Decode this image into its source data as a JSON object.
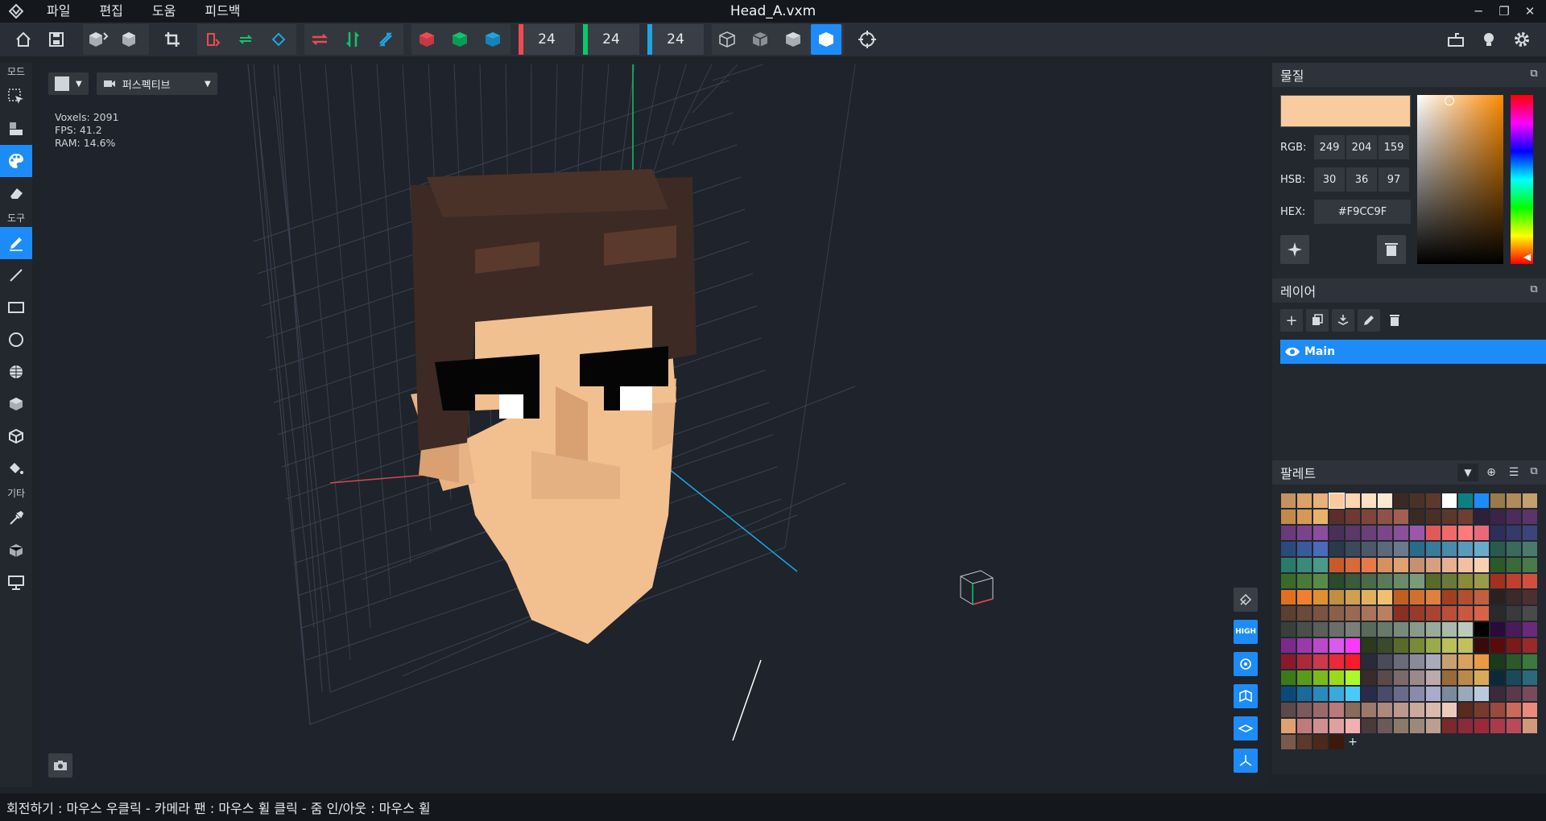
{
  "app": {
    "title": "Head_A.vxm"
  },
  "menu": [
    "파일",
    "편집",
    "도움",
    "피드백"
  ],
  "toolbar": {
    "size_x": "24",
    "size_y": "24",
    "size_z": "24"
  },
  "left_tools": {
    "mode_label": "모드",
    "tools_label": "도구",
    "other_label": "기타"
  },
  "viewport": {
    "view_mode": "퍼스펙티브",
    "stats": {
      "voxels": "Voxels: 2091",
      "fps": "FPS: 41.2",
      "ram": "RAM: 14.6%"
    },
    "quality": "HIGH"
  },
  "material": {
    "title": "물질",
    "color": "#F9CC9F",
    "rgb_label": "RGB:",
    "rgb": [
      "249",
      "204",
      "159"
    ],
    "hsb_label": "HSB:",
    "hsb": [
      "30",
      "36",
      "97"
    ],
    "hex_label": "HEX:",
    "hex": "#F9CC9F"
  },
  "layers": {
    "title": "레이어",
    "items": [
      {
        "name": "Main",
        "visible": true,
        "selected": true
      }
    ]
  },
  "palette": {
    "title": "팔레트",
    "colors": [
      "#c4915f",
      "#d9a26b",
      "#e8b07a",
      "#f9cc9f",
      "#fbd6b0",
      "#fce0c3",
      "#fde9d3",
      "#3a2a24",
      "#4a3128",
      "#5b3a2e",
      "#ffffff",
      "#0d7f82",
      "#1d8cf8",
      "#9a7a4a",
      "#b08c5a",
      "#c4a06c",
      "#c08a4a",
      "#d49a55",
      "#e6b36a",
      "#5a2f2a",
      "#6b3a33",
      "#7d463d",
      "#8f5248",
      "#a15f52",
      "#3a2a24",
      "#4a2f26",
      "#5b372c",
      "#6d3f31",
      "#2e1f3a",
      "#3a2448",
      "#4a2d5a",
      "#5a356a",
      "#6a3a7a",
      "#7a448a",
      "#8a4e9a",
      "#4a3058",
      "#5a3868",
      "#6a4078",
      "#7a4888",
      "#8a5098",
      "#9a58a8",
      "#e05a5a",
      "#f06a6a",
      "#ff7a7a",
      "#e86a7a",
      "#2c2f5a",
      "#343a6a",
      "#3c457a",
      "#2a4a7a",
      "#3a5a9a",
      "#4a6aba",
      "#2a3a4a",
      "#3a4a5a",
      "#4a5a6a",
      "#5a6a7a",
      "#6a7a8a",
      "#2a6a8a",
      "#3a7a9a",
      "#4a8aaa",
      "#5a9aba",
      "#6aaaca",
      "#2a5a4a",
      "#3a6a5a",
      "#4a7a6a",
      "#2a7a6a",
      "#3a8a7a",
      "#4a9a8a",
      "#c85a2a",
      "#d86a3a",
      "#e87a4a",
      "#d89060",
      "#e0a070",
      "#c89070",
      "#d8a080",
      "#e8b090",
      "#f0c0a0",
      "#f8d0b0",
      "#2a5a2a",
      "#3a6a3a",
      "#4a7a4a",
      "#3a6a2a",
      "#4a7a3a",
      "#5a8a4a",
      "#2a4a2a",
      "#3a5a3a",
      "#4a6a4a",
      "#5a7a5a",
      "#6a8a6a",
      "#7a9a7a",
      "#5a6a2a",
      "#6a7a3a",
      "#8a8a3a",
      "#9a9a4a",
      "#a03020",
      "#c04030",
      "#d05040",
      "#e07020",
      "#f08030",
      "#e09030",
      "#c09040",
      "#d0a050",
      "#e0b060",
      "#f0c070",
      "#c06020",
      "#d07030",
      "#e08040",
      "#a04020",
      "#b05030",
      "#c06040",
      "#2a2020",
      "#3a2a2a",
      "#4a3030",
      "#5a4030",
      "#6a4a38",
      "#7a5440",
      "#8a6048",
      "#9a6a50",
      "#aa7458",
      "#ba8060",
      "#8a3020",
      "#9a3a28",
      "#aa4430",
      "#ba4e38",
      "#ca5840",
      "#da6248",
      "#2a2a2a",
      "#3a3a3a",
      "#4a4a4a",
      "#3a3f3a",
      "#4a4f4a",
      "#5a5f5a",
      "#6a6f6a",
      "#7a7f7a",
      "#5a6a5a",
      "#6a7a6a",
      "#7a8a7a",
      "#8a9a8a",
      "#9aaa9a",
      "#aabaaa",
      "#bacaba",
      "#000000",
      "#2a0a3a",
      "#4a1a5a",
      "#6a2a7a",
      "#7a2a8a",
      "#9a3aaa",
      "#ba4aca",
      "#da5aea",
      "#fa3afa",
      "#2a3a1a",
      "#3a4a2a",
      "#5a6a2a",
      "#7a8a3a",
      "#9aaa4a",
      "#bac05a",
      "#c0c060",
      "#3a0a0a",
      "#5a0a0a",
      "#7a1a1a",
      "#9a2a2a",
      "#8a1a2a",
      "#aa2a3a",
      "#ca3a4a",
      "#ea2a3a",
      "#fa1a2a",
      "#2a2a3a",
      "#4a4a5a",
      "#6a6a7a",
      "#8a8a9a",
      "#aaaaba",
      "#caa070",
      "#daa060",
      "#ea9a40",
      "#1a3a1a",
      "#2a5a2a",
      "#3a7a3a",
      "#3a7a1a",
      "#5a9a1a",
      "#7aba1a",
      "#9ada1a",
      "#aafa2a",
      "#3a2a2a",
      "#5a4a4a",
      "#7a6a6a",
      "#9a8a8a",
      "#baaaaa",
      "#9a6a3a",
      "#ba8a4a",
      "#daaa5a",
      "#0a2a3a",
      "#1a4a5a",
      "#2a6a7a",
      "#0a4a7a",
      "#1a6a9a",
      "#2a8aba",
      "#3aaada",
      "#4acafa",
      "#2a2a4a",
      "#4a4a6a",
      "#6a6a8a",
      "#8a8aaa",
      "#aaaaca",
      "#7a8a9a",
      "#9aaaba",
      "#bacada",
      "#3a2a3a",
      "#5a3a4a",
      "#7a4a5a",
      "#5a4a4a",
      "#7a5a5a",
      "#9a6a6a",
      "#ba7a7a",
      "#8a6a5a",
      "#9a7a6a",
      "#aa8a7a",
      "#ba9a8a",
      "#caa a9a",
      "#daba aa",
      "#eacaba",
      "#5a2a1a",
      "#7a3a2a",
      "#9a4a3a",
      "#ca6a5a",
      "#ea8a7a",
      "#e0a070",
      "#c07a7a",
      "#d09090",
      "#e0a0a0",
      "#f0b0b0",
      "#4a3a3a",
      "#6a5a5a",
      "#8a7a6a",
      "#9a8a7a",
      "#baa090",
      "#7a2a2a",
      "#8a2a3a",
      "#9a2a3a",
      "#aa3a4a",
      "#ba4a5a",
      "#d09a7a",
      "#7a5a4a",
      "#5a3a2a",
      "#4a2a1a",
      "#3a1a0a"
    ]
  },
  "statusbar": {
    "hint": "회전하기 : 마우스 우클릭 - 카메라 팬 : 마우스 휠 클릭 - 줌 인/아웃 : 마우스 휠"
  }
}
